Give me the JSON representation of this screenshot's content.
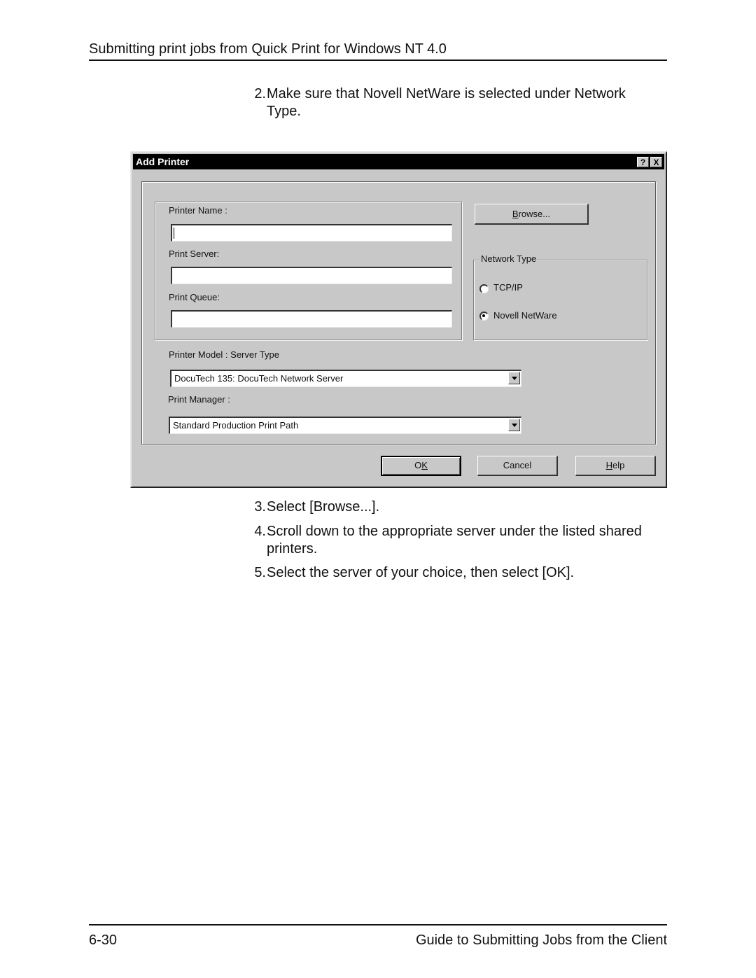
{
  "page": {
    "header": "Submitting print jobs from Quick Print for Windows NT 4.0",
    "steps_before": [
      {
        "num": "2.",
        "lines": [
          "Make sure that Novell NetWare is selected under Network",
          "Type."
        ]
      }
    ],
    "steps_after": [
      {
        "num": "3.",
        "lines": [
          "Select [Browse...]."
        ]
      },
      {
        "num": "4.",
        "lines": [
          "Scroll down to the appropriate server under the listed shared",
          "printers."
        ]
      },
      {
        "num": "5.",
        "lines": [
          "Select the server of your choice, then select [OK]."
        ]
      }
    ],
    "footer": {
      "page_number": "6-30",
      "title": "Guide to Submitting Jobs from the Client"
    }
  },
  "dialog": {
    "title": "Add Printer",
    "help_button": "?",
    "close_button": "X",
    "printer_name": {
      "label": "Printer Name :",
      "value": ""
    },
    "print_server": {
      "label": "Print Server:",
      "value": ""
    },
    "print_queue": {
      "label": "Print Queue:",
      "value": ""
    },
    "browse_button": {
      "mnemonic": "B",
      "rest": "rowse..."
    },
    "network_type": {
      "legend": "Network Type",
      "options": [
        {
          "label": "TCP/IP",
          "selected": false
        },
        {
          "label": "Novell NetWare",
          "selected": true
        }
      ]
    },
    "printer_model": {
      "label": "Printer Model : Server Type",
      "value": "DocuTech 135: DocuTech Network Server"
    },
    "print_manager": {
      "label": "Print Manager :",
      "value": "Standard Production Print Path"
    },
    "ok_button": {
      "pre": "O",
      "mnemonic": "K"
    },
    "cancel_button": "Cancel",
    "help_btn": {
      "mnemonic": "H",
      "rest": "elp"
    }
  }
}
